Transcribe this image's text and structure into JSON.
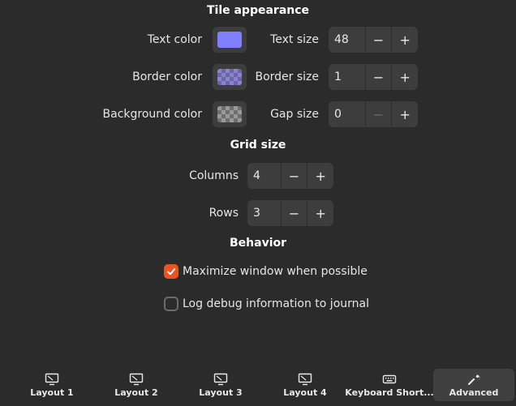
{
  "tile_appearance": {
    "title": "Tile appearance",
    "text_color": {
      "label": "Text color",
      "color": "#7f7fff"
    },
    "border_color": {
      "label": "Border color",
      "color": "#7f7fff",
      "pattern": "checkerboard"
    },
    "background_color": {
      "label": "Background color",
      "pattern": "checkerboard"
    },
    "text_size": {
      "label": "Text size",
      "value": "48"
    },
    "border_size": {
      "label": "Border size",
      "value": "1"
    },
    "gap_size": {
      "label": "Gap size",
      "value": "0"
    },
    "minus": "−",
    "plus": "+"
  },
  "grid_size": {
    "title": "Grid size",
    "columns": {
      "label": "Columns",
      "value": "4"
    },
    "rows": {
      "label": "Rows",
      "value": "3"
    }
  },
  "behavior": {
    "title": "Behavior",
    "maximize": {
      "label": "Maximize window when possible",
      "checked": true
    },
    "debug": {
      "label": "Log debug information to journal",
      "checked": false
    }
  },
  "tabs": [
    {
      "label": "Layout 1",
      "icon": "monitor-icon"
    },
    {
      "label": "Layout 2",
      "icon": "monitor-icon"
    },
    {
      "label": "Layout 3",
      "icon": "monitor-icon"
    },
    {
      "label": "Layout 4",
      "icon": "monitor-icon"
    },
    {
      "label": "Keyboard Short...",
      "icon": "keyboard-icon"
    },
    {
      "label": "Advanced",
      "icon": "wrench-icon",
      "active": true
    }
  ],
  "colors": {
    "accent": "#e95420",
    "background": "#2b2b2b",
    "widget": "#3d3d3d"
  }
}
